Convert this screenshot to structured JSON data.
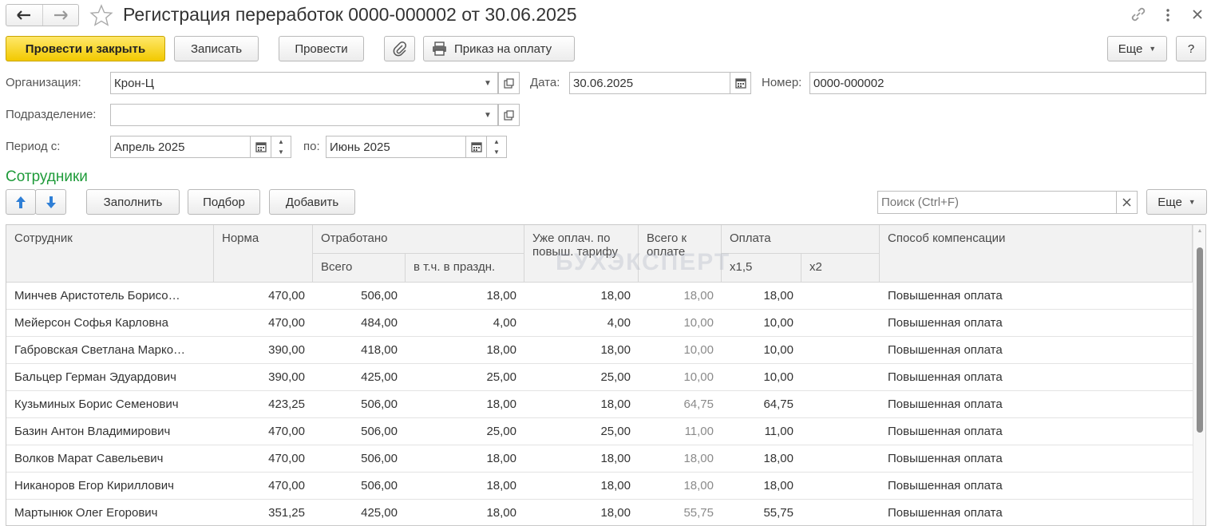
{
  "window": {
    "title": "Регистрация переработок 0000-000002 от 30.06.2025"
  },
  "toolbar": {
    "post_close": "Провести и закрыть",
    "save": "Записать",
    "post": "Провести",
    "print_order": "Приказ на оплату",
    "more": "Еще",
    "help": "?"
  },
  "form": {
    "org_label": "Организация:",
    "org_value": "Крон-Ц",
    "date_label": "Дата:",
    "date_value": "30.06.2025",
    "number_label": "Номер:",
    "number_value": "0000-000002",
    "division_label": "Подразделение:",
    "division_value": "",
    "period_from_label": "Период с:",
    "period_from_value": "Апрель 2025",
    "period_to_label": "по:",
    "period_to_value": "Июнь 2025"
  },
  "employees_section": {
    "title": "Сотрудники",
    "fill": "Заполнить",
    "select": "Подбор",
    "add": "Добавить",
    "search_placeholder": "Поиск (Ctrl+F)",
    "more": "Еще"
  },
  "watermark": "БУХЭКСПЕРТ",
  "table": {
    "headers": {
      "employee": "Сотрудник",
      "norm": "Норма",
      "worked": "Отработано",
      "worked_total": "Всего",
      "worked_holidays": "в т.ч. в праздн.",
      "already_paid": "Уже оплач. по повыш. тарифу",
      "total_to_pay": "Всего к оплате",
      "payment": "Оплата",
      "x15": "х1,5",
      "x2": "х2",
      "compensation": "Способ компенсации"
    },
    "rows": [
      {
        "employee": "Минчев Аристотель Борисо…",
        "norm": "470,00",
        "worked": "506,00",
        "holidays": "18,00",
        "paid": "18,00",
        "total": "18,00",
        "x15": "18,00",
        "x2": "",
        "comp": "Повышенная оплата"
      },
      {
        "employee": "Мейерсон Софья Карловна",
        "norm": "470,00",
        "worked": "484,00",
        "holidays": "4,00",
        "paid": "4,00",
        "total": "10,00",
        "x15": "10,00",
        "x2": "",
        "comp": "Повышенная оплата"
      },
      {
        "employee": "Габровская Светлана Марко…",
        "norm": "390,00",
        "worked": "418,00",
        "holidays": "18,00",
        "paid": "18,00",
        "total": "10,00",
        "x15": "10,00",
        "x2": "",
        "comp": "Повышенная оплата"
      },
      {
        "employee": "Бальцер Герман Эдуардович",
        "norm": "390,00",
        "worked": "425,00",
        "holidays": "25,00",
        "paid": "25,00",
        "total": "10,00",
        "x15": "10,00",
        "x2": "",
        "comp": "Повышенная оплата"
      },
      {
        "employee": "Кузьминых Борис Семенович",
        "norm": "423,25",
        "worked": "506,00",
        "holidays": "18,00",
        "paid": "18,00",
        "total": "64,75",
        "x15": "64,75",
        "x2": "",
        "comp": "Повышенная оплата"
      },
      {
        "employee": "Базин Антон Владимирович",
        "norm": "470,00",
        "worked": "506,00",
        "holidays": "25,00",
        "paid": "25,00",
        "total": "11,00",
        "x15": "11,00",
        "x2": "",
        "comp": "Повышенная оплата"
      },
      {
        "employee": "Волков Марат Савельевич",
        "norm": "470,00",
        "worked": "506,00",
        "holidays": "18,00",
        "paid": "18,00",
        "total": "18,00",
        "x15": "18,00",
        "x2": "",
        "comp": "Повышенная оплата"
      },
      {
        "employee": "Никаноров Егор Кириллович",
        "norm": "470,00",
        "worked": "506,00",
        "holidays": "18,00",
        "paid": "18,00",
        "total": "18,00",
        "x15": "18,00",
        "x2": "",
        "comp": "Повышенная оплата"
      },
      {
        "employee": "Мартынюк Олег Егорович",
        "norm": "351,25",
        "worked": "425,00",
        "holidays": "18,00",
        "paid": "18,00",
        "total": "55,75",
        "x15": "55,75",
        "x2": "",
        "comp": "Повышенная оплата"
      }
    ]
  },
  "colors": {
    "primary_button": "#f2c900",
    "section_title": "#1f9b3a",
    "arrow_blue": "#2f7fd6"
  },
  "icons": [
    "back-arrow-icon",
    "forward-arrow-icon",
    "star-icon",
    "link-icon",
    "kebab-icon",
    "close-icon",
    "paperclip-icon",
    "printer-icon",
    "calendar-icon",
    "dropdown-icon",
    "open-icon",
    "move-up-icon",
    "move-down-icon"
  ]
}
